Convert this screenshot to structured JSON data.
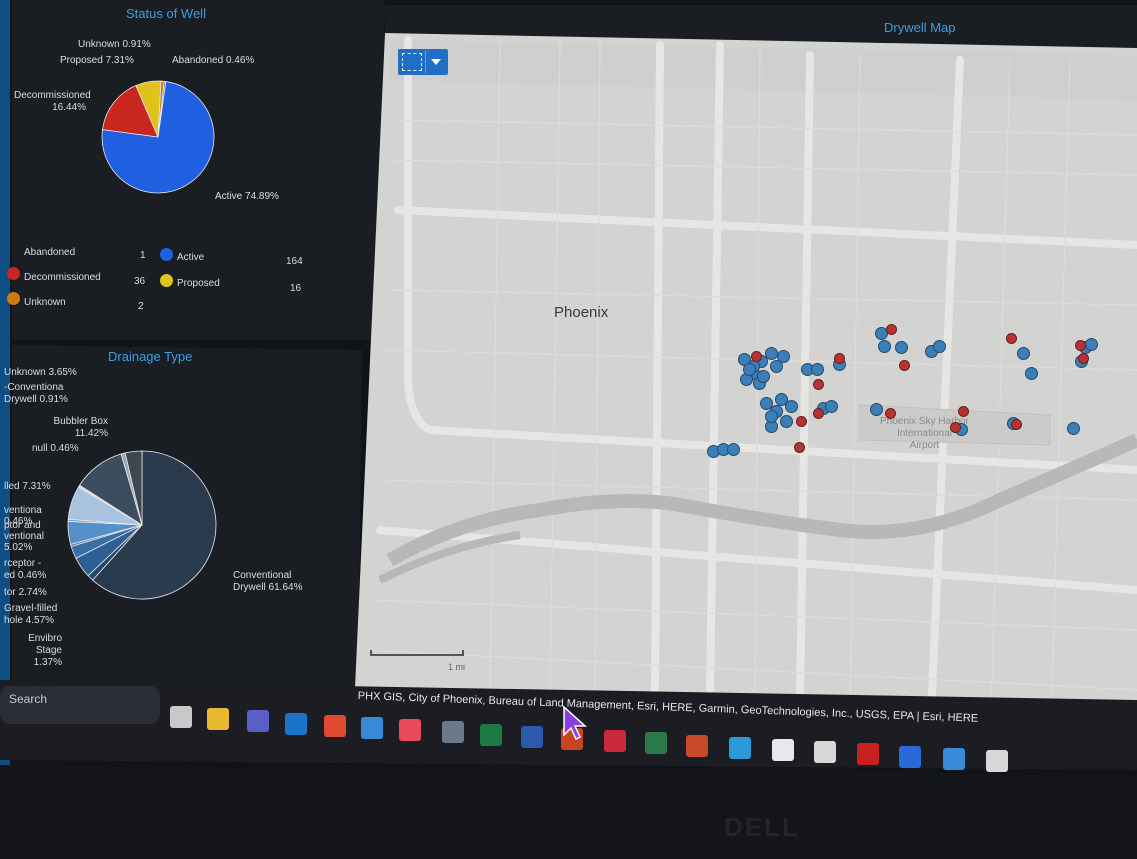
{
  "colors": {
    "active": "#1f5fe0",
    "decommissioned": "#c8261e",
    "proposed": "#e0c21a",
    "unknown": "#d07a10",
    "abandoned": "#777777",
    "title_blue": "#3a9fe0",
    "marker_blue": "#3b7fb8",
    "marker_red": "#b83232"
  },
  "status_panel": {
    "title": "Status of Well",
    "slices": [
      {
        "label": "Active 74.89%",
        "percent": 74.89
      },
      {
        "label": "Decommissioned\n16.44%",
        "percent": 16.44
      },
      {
        "label": "Proposed 7.31%",
        "percent": 7.31
      },
      {
        "label": "Unknown 0.91%",
        "percent": 0.91
      },
      {
        "label": "Abandoned 0.46%",
        "percent": 0.46
      }
    ],
    "legend": [
      {
        "name": "Abandoned",
        "count": "1",
        "icon": "gray-circle"
      },
      {
        "name": "Decommissioned",
        "count": "36",
        "icon": "red-circle"
      },
      {
        "name": "Unknown",
        "count": "2",
        "icon": "orange-circle"
      },
      {
        "name": "Active",
        "count": "164",
        "icon": "blue-circle"
      },
      {
        "name": "Proposed",
        "count": "16",
        "icon": "yellow-circle"
      }
    ]
  },
  "drainage_panel": {
    "title": "Drainage Type",
    "slices": [
      {
        "label": "Conventional\nDrywell 61.64%",
        "percent": 61.64
      },
      {
        "label": "Envibro Stage\n1.37%",
        "percent": 1.37
      },
      {
        "label": "Gravel-filled\nhole 4.57%",
        "percent": 4.57
      },
      {
        "label": "tor 2.74%",
        "percent": 2.74
      },
      {
        "label": "rceptor -\ned 0.46%",
        "percent": 0.46
      },
      {
        "label": "ventional\n5.02%",
        "percent": 5.02
      },
      {
        "label": "ventiona\n0.46%",
        "percent": 0.46
      },
      {
        "label": "lled 7.31%",
        "percent": 7.31
      },
      {
        "label": "null 0.46%",
        "percent": 0.46
      },
      {
        "label": "Bubbler Box\n11.42%",
        "percent": 11.42
      },
      {
        "label": "-Conventiona\nDrywell 0.91%",
        "percent": 0.91
      },
      {
        "label": "Unknown 3.65%",
        "percent": 3.65
      }
    ],
    "extra_label": "ptor and"
  },
  "map_panel": {
    "title": "Drywell Map",
    "city_label": "Phoenix",
    "airport_label": "Phoenix Sky Harbor\nInternational\nAirport",
    "attribution": "PHX GIS, City of Phoenix, Bureau of Land Management, Esri, HERE, Garmin, GeoTechnologies, Inc., USGS, EPA | Esri, HERE",
    "scale_label": "1 mi",
    "tool_icon": "select-icon",
    "dropdown_icon": "caret-down-icon"
  },
  "taskbar": {
    "search_placeholder": "Search",
    "apps": [
      {
        "name": "task-view-icon",
        "color": "#c8c8c8"
      },
      {
        "name": "file-explorer-icon",
        "color": "#e8b830"
      },
      {
        "name": "teams-icon",
        "color": "#5a5fc8"
      },
      {
        "name": "outlook-icon",
        "color": "#1a73c8"
      },
      {
        "name": "chrome-icon",
        "color": "#e04a30"
      },
      {
        "name": "folder-icon",
        "color": "#3a8ad8"
      },
      {
        "name": "snipping-tool-icon",
        "color": "#e84a5a"
      },
      {
        "name": "calculator-icon",
        "color": "#6a7a8a"
      },
      {
        "name": "excel-icon",
        "color": "#1e7a44"
      },
      {
        "name": "word-icon",
        "color": "#2a5aa8"
      },
      {
        "name": "powerpoint-icon",
        "color": "#c8441e"
      },
      {
        "name": "app-d-icon",
        "color": "#c82a3a"
      },
      {
        "name": "project-icon",
        "color": "#2a7a4a"
      },
      {
        "name": "paint-icon",
        "color": "#c84a2a"
      },
      {
        "name": "edge-icon",
        "color": "#2a9ad8"
      },
      {
        "name": "notepad-icon",
        "color": "#e8e8e8"
      },
      {
        "name": "flame-icon",
        "color": "#d8d8d8"
      },
      {
        "name": "acrobat-icon",
        "color": "#c82020"
      },
      {
        "name": "webex-icon",
        "color": "#2a6ad8"
      },
      {
        "name": "photos-icon",
        "color": "#3a8ad8"
      },
      {
        "name": "flame-icon-2",
        "color": "#d8d8d8"
      }
    ]
  },
  "laptop_brand": "DELL"
}
